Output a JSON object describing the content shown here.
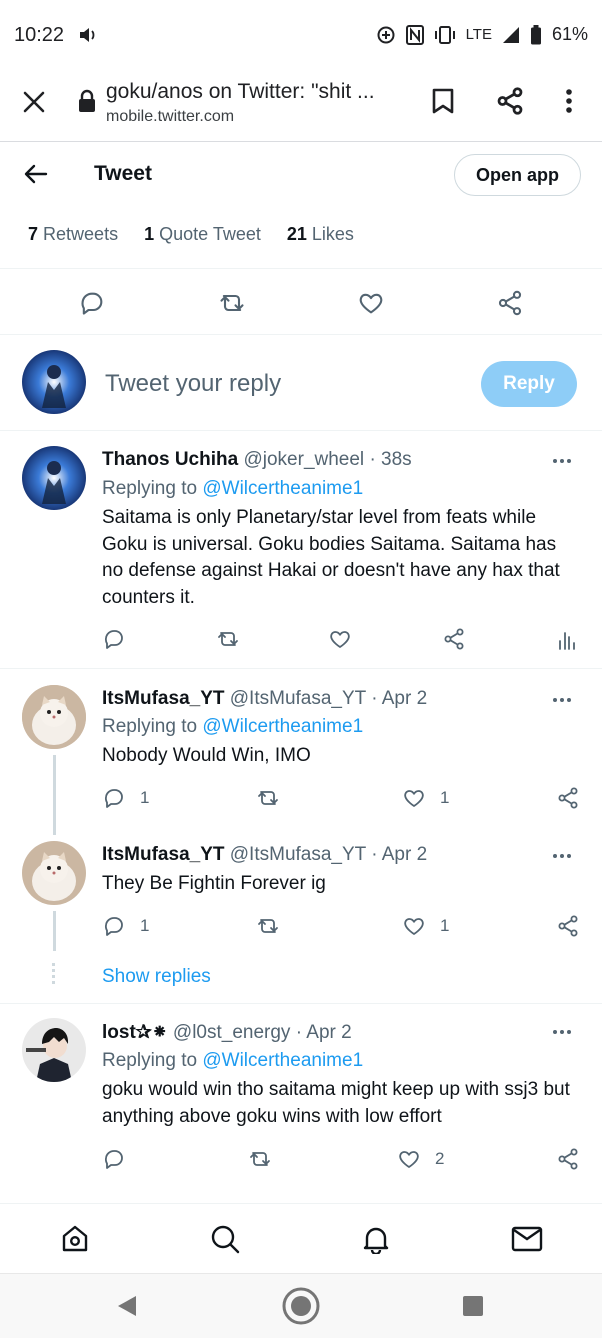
{
  "status_bar": {
    "time": "10:22",
    "network": "LTE",
    "battery": "61%"
  },
  "browser": {
    "title": "goku/anos on Twitter: \"shit ...",
    "url": "mobile.twitter.com"
  },
  "header": {
    "title": "Tweet",
    "open_app": "Open app"
  },
  "stats": {
    "retweets_count": "7",
    "retweets_label": "Retweets",
    "quotes_count": "1",
    "quotes_label": "Quote Tweet",
    "likes_count": "21",
    "likes_label": "Likes"
  },
  "composer": {
    "placeholder": "Tweet your reply",
    "reply_button": "Reply"
  },
  "replies": [
    {
      "name": "Thanos Uchiha",
      "handle": "@joker_wheel",
      "time": "· 38s",
      "replying_prefix": "Replying to",
      "replying_to": "@Wilcertheanime1",
      "text": "Saitama is only Planetary/star level from feats while Goku is universal. Goku bodies Saitama. Saitama has no defense against Hakai or doesn't have any hax that counters it."
    },
    {
      "name": "ItsMufasa_YT",
      "handle": "@ItsMufasa_YT",
      "time": "· Apr 2",
      "replying_prefix": "Replying to",
      "replying_to": "@Wilcertheanime1",
      "text": "Nobody Would Win, IMO",
      "reply_count": "1",
      "like_count": "1"
    },
    {
      "name": "ItsMufasa_YT",
      "handle": "@ItsMufasa_YT",
      "time": "· Apr 2",
      "text": "They Be Fightin Forever ig",
      "reply_count": "1",
      "like_count": "1"
    },
    {
      "name": "lost✰⁕",
      "handle": "@l0st_energy",
      "time": "· Apr 2",
      "replying_prefix": "Replying to",
      "replying_to": "@Wilcertheanime1",
      "text": "goku would win tho saitama might keep up with ssj3 but anything above goku wins with low effort",
      "like_count": "2"
    }
  ],
  "show_replies": "Show replies",
  "colors": {
    "link": "#1d9bf0",
    "reply_button": "#8ecdf7",
    "muted": "#536471"
  },
  "icons": [
    "close-icon",
    "lock-icon",
    "bookmark-icon",
    "share-icon",
    "more-vert-icon",
    "back-arrow-icon",
    "reply-icon",
    "retweet-icon",
    "like-icon",
    "share-icon",
    "analytics-icon",
    "more-horizontal-icon",
    "home-icon",
    "search-icon",
    "notifications-icon",
    "messages-icon"
  ]
}
